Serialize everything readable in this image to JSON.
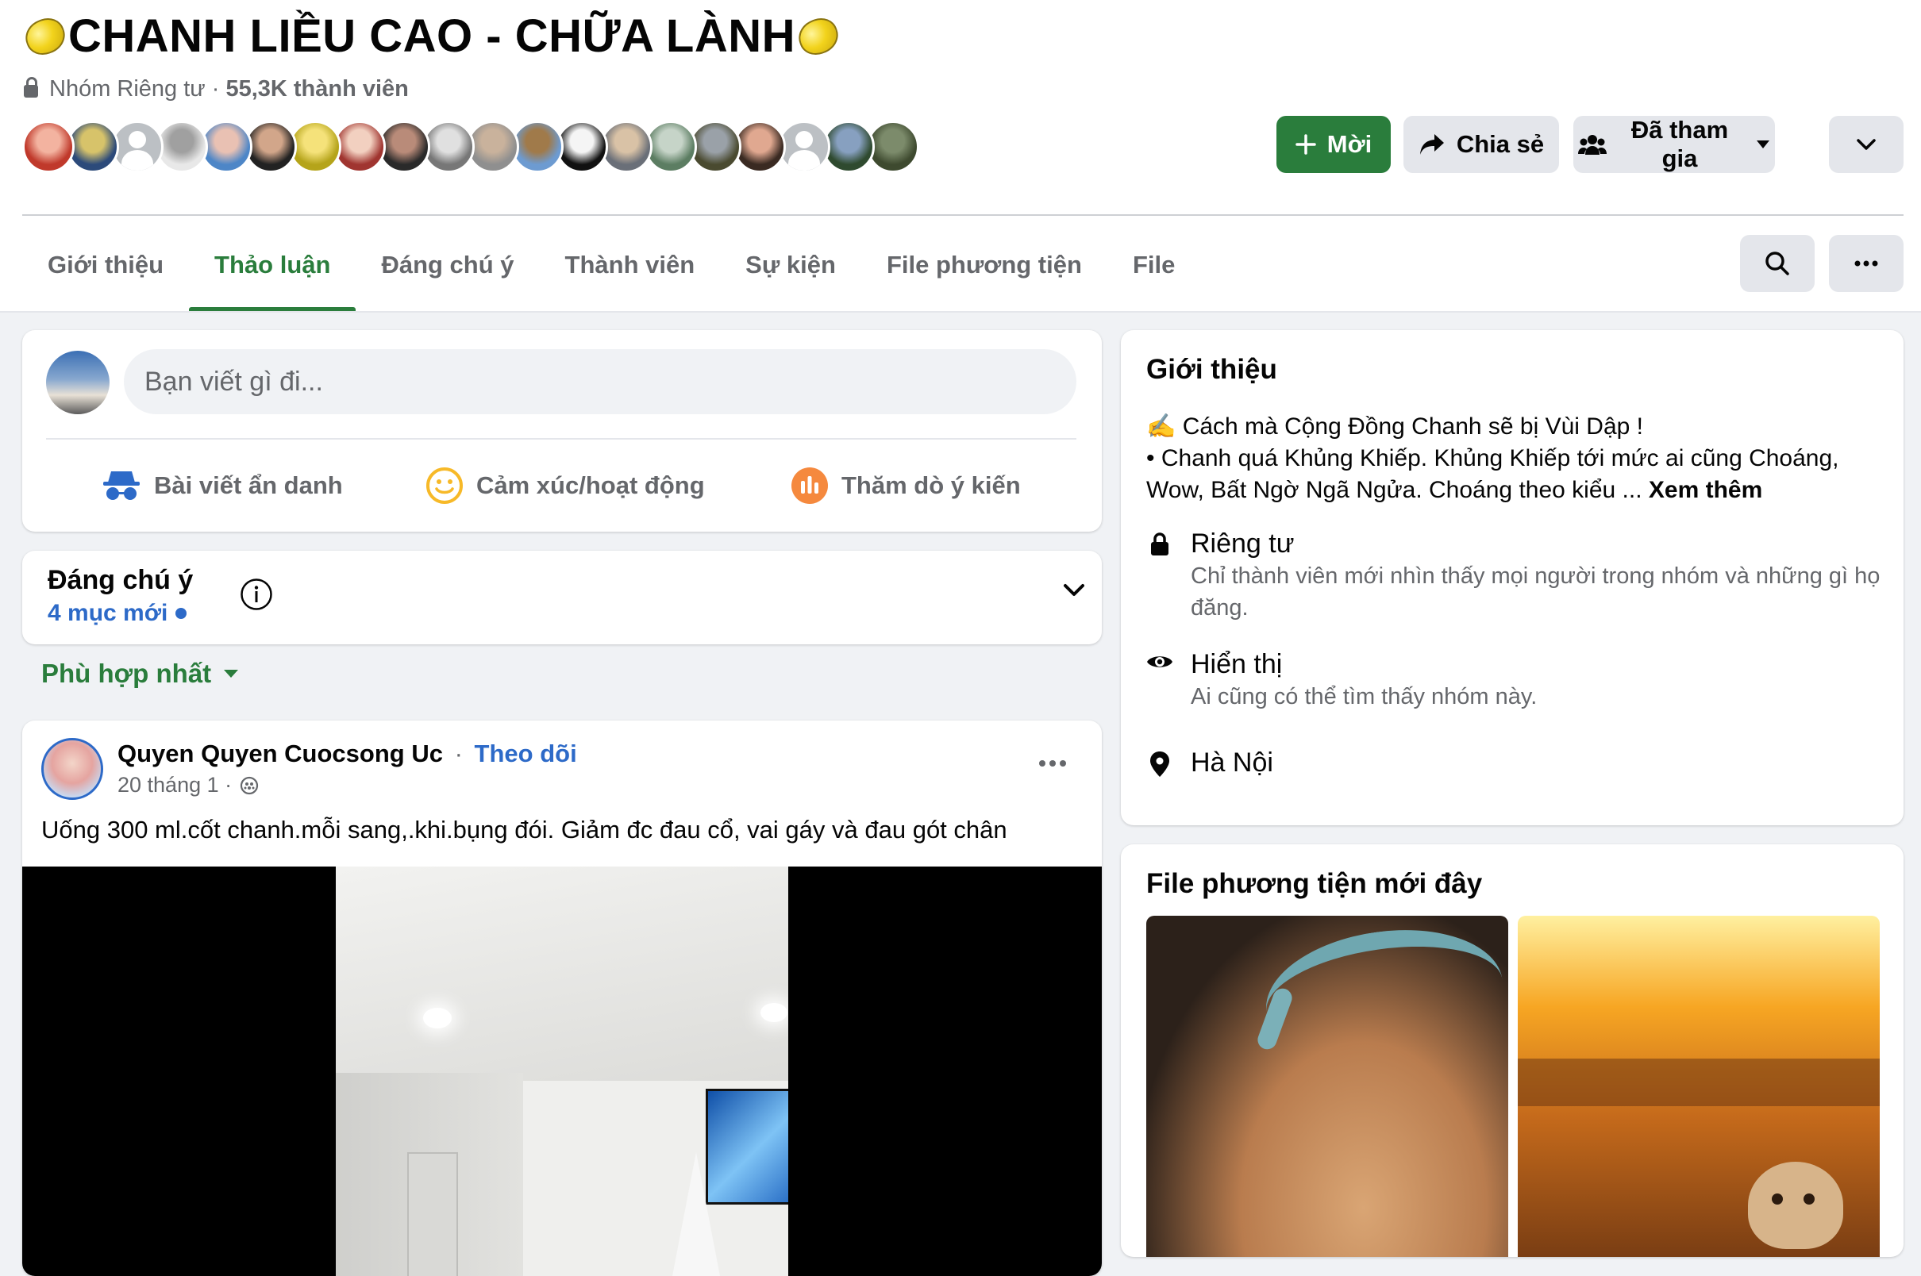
{
  "header": {
    "title": "CHANH LIỀU CAO - CHỮA LÀNH",
    "privacy": "Nhóm Riêng tư ·",
    "members": "55,3K thành viên",
    "buttons": {
      "invite": "Mời",
      "share": "Chia sẻ",
      "joined": "Đã tham gia"
    }
  },
  "member_avatars": [
    {
      "c1": "#c0392b",
      "c2": "#f3b3a0"
    },
    {
      "c1": "#2c4a7a",
      "c2": "#d7c36a"
    },
    {
      "generic": true
    },
    {
      "c1": "#e8e8e8",
      "c2": "#a0a0a0"
    },
    {
      "c1": "#4d86c7",
      "c2": "#e9c1b3"
    },
    {
      "c1": "#222222",
      "c2": "#d2a68a"
    },
    {
      "c1": "#b5a41a",
      "c2": "#f5e27a"
    },
    {
      "c1": "#a03530",
      "c2": "#f2d0c0"
    },
    {
      "c1": "#2a2a2a",
      "c2": "#b98b79"
    },
    {
      "c1": "#777777",
      "c2": "#e0e0e0"
    },
    {
      "c1": "#8f8f8f",
      "c2": "#c9b29c"
    },
    {
      "c1": "#6d9bd1",
      "c2": "#a07a4a"
    },
    {
      "c1": "#111111",
      "c2": "#f5f5f5"
    },
    {
      "c1": "#6a6f78",
      "c2": "#d9c2a6"
    },
    {
      "c1": "#5c7d62",
      "c2": "#c6d4c8"
    },
    {
      "c1": "#4a4a30",
      "c2": "#9aa1a8"
    },
    {
      "c1": "#3a2a22",
      "c2": "#e0a890"
    },
    {
      "generic": true
    },
    {
      "c1": "#2f4a2f",
      "c2": "#87a0c0"
    },
    {
      "c1": "#3e4a2f",
      "c2": "#7c8b6b"
    }
  ],
  "tabs": [
    "Giới thiệu",
    "Thảo luận",
    "Đáng chú ý",
    "Thành viên",
    "Sự kiện",
    "File phương tiện",
    "File"
  ],
  "active_tab": "Thảo luận",
  "composer": {
    "placeholder": "Bạn viết gì đi...",
    "actions": {
      "anonymous": "Bài viết ẩn danh",
      "feeling": "Cảm xúc/hoạt động",
      "poll": "Thăm dò ý kiến"
    }
  },
  "highlights": {
    "title": "Đáng chú ý",
    "new_items": "4 mục mới"
  },
  "sort": {
    "label": "Phù hợp nhất"
  },
  "post": {
    "author": "Quyen Quyen Cuocsong Uc",
    "separator": "·",
    "follow": "Theo dõi",
    "date": "20 tháng 1 ·",
    "text": "Uống 300 ml.cốt chanh.mỗi sang,.khi.bụng đói. Giảm đc đau cổ, vai gáy và đau gót chân"
  },
  "about": {
    "title": "Giới thiệu",
    "line1": "✍️ Cách mà Cộng Đồng Chanh sẽ bị Vùi Dập !",
    "line2": "• Chanh quá Khủng Khiếp. Khủng Khiếp tới mức ai cũng Choáng, Wow, Bất Ngờ Ngã Ngửa. Choáng theo kiểu ...",
    "see_more": "Xem thêm",
    "private_title": "Riêng tư",
    "private_desc": "Chỉ thành viên mới nhìn thấy mọi người trong nhóm và những gì họ đăng.",
    "visible_title": "Hiển thị",
    "visible_desc": "Ai cũng có thể tìm thấy nhóm này.",
    "location": "Hà Nội"
  },
  "media": {
    "title": "File phương tiện mới đây"
  },
  "colors": {
    "accent": "#2a7d3c",
    "link": "#2d6ac8",
    "secondary_text": "#65676b",
    "button_gray": "#e4e6eb"
  },
  "icons": [
    "lock-icon",
    "plus-icon",
    "share-arrow-icon",
    "group-icon",
    "caret-down-icon",
    "chevron-down-icon",
    "search-icon",
    "more-dots-icon",
    "incognito-icon",
    "smiley-icon",
    "poll-icon",
    "info-icon",
    "globe-icon",
    "eye-icon",
    "location-pin-icon",
    "lemon-icon"
  ]
}
